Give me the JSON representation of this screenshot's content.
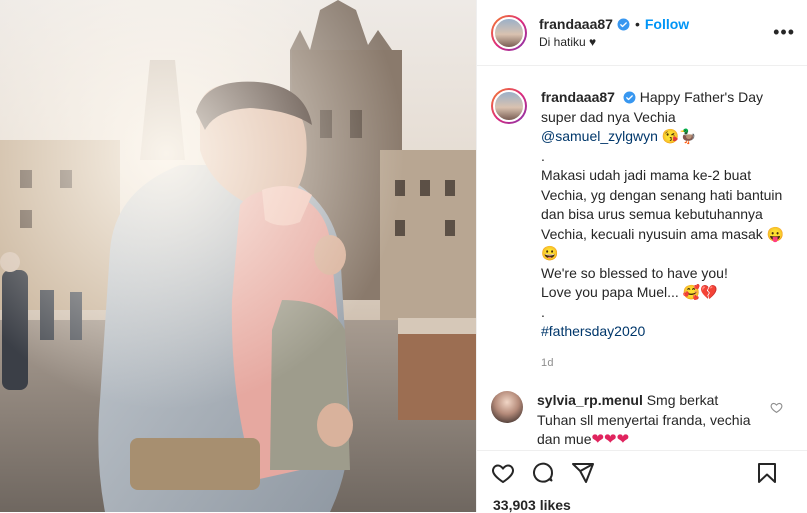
{
  "post": {
    "username": "frandaaa87",
    "follow_label": "Follow",
    "location": "Di hatiku ♥",
    "caption_lines": [
      "Happy Father's Day",
      "super dad nya Vechia",
      "@samuel_zylgwyn",
      ".",
      "Makasi udah jadi mama ke-2 buat",
      "Vechia, yg dengan senang hati bantuin",
      "dan bisa urus semua kebutuhannya",
      "Vechia, kecuali nyusuin ama masak",
      "😀",
      "We're so blessed to have you!",
      "Love you papa Muel...",
      ".",
      "#fathersday2020"
    ],
    "emoji_after_mention": "😘🦆",
    "emoji_after_masak": "😛",
    "emoji_after_muel": "🥰💔",
    "time": "1d",
    "likes": "33,903 likes"
  },
  "comment": {
    "username": "sylvia_rp.menul",
    "text_1": "Smg berkat",
    "text_2": "Tuhan sll menyertai franda, vechia",
    "text_3": "dan mue",
    "hearts": "❤❤❤"
  },
  "icons": [
    "verified-badge-icon",
    "more-options-icon",
    "heart-icon",
    "comment-icon",
    "share-icon",
    "bookmark-icon"
  ],
  "colors": {
    "follow": "#0095f6",
    "link": "#00376b",
    "muted": "#8e8e8e"
  }
}
